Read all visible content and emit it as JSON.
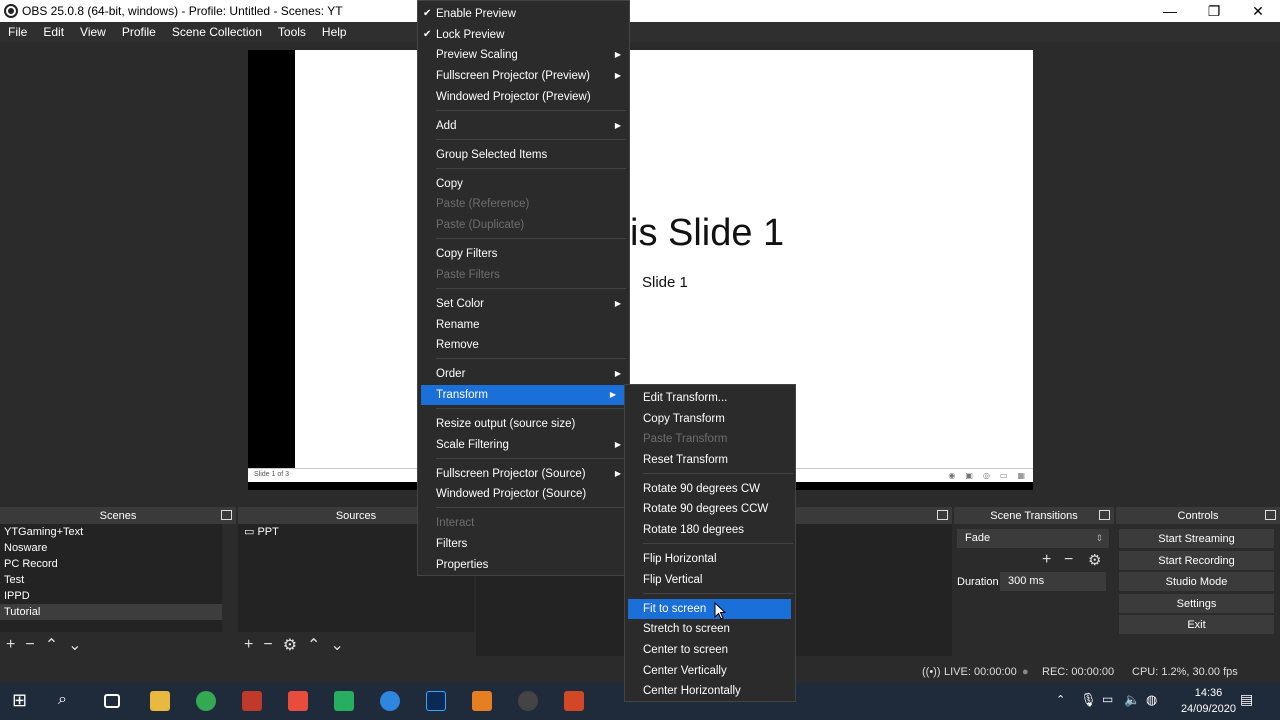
{
  "window": {
    "title": "OBS 25.0.8 (64-bit, windows) - Profile: Untitled - Scenes: YT",
    "minimize": "—",
    "maximize": "❐",
    "close": "✕"
  },
  "menubar": [
    "File",
    "Edit",
    "View",
    "Profile",
    "Scene Collection",
    "Tools",
    "Help"
  ],
  "preview": {
    "slide_title": "is Slide 1",
    "slide_subtitle": "Slide 1",
    "slide_counter": "Slide 1 of 3"
  },
  "docks": {
    "scenes": {
      "title": "Scenes",
      "items": [
        "YTGaming+Text",
        "Nosware",
        "PC Record",
        "Test",
        "IPPD",
        "Tutorial"
      ],
      "selected": "Tutorial"
    },
    "sources": {
      "title": "Sources",
      "items": [
        "PPT"
      ]
    },
    "transitions": {
      "title": "Scene Transitions",
      "selected": "Fade",
      "duration_label": "Duration",
      "duration_value": "300 ms"
    },
    "controls": {
      "title": "Controls",
      "buttons": [
        "Start Streaming",
        "Start Recording",
        "Studio Mode",
        "Settings",
        "Exit"
      ]
    }
  },
  "statusbar": {
    "live": "LIVE: 00:00:00",
    "rec": "REC: 00:00:00",
    "cpu": "CPU: 1.2%, 30.00 fps"
  },
  "context_menu": {
    "items": [
      "Enable Preview",
      "Lock Preview",
      "Preview Scaling",
      "Fullscreen Projector (Preview)",
      "Windowed Projector (Preview)",
      "Add",
      "Group Selected Items",
      "Copy",
      "Paste (Reference)",
      "Paste (Duplicate)",
      "Copy Filters",
      "Paste Filters",
      "Set Color",
      "Rename",
      "Remove",
      "Order",
      "Transform",
      "Resize output (source size)",
      "Scale Filtering",
      "Fullscreen Projector (Source)",
      "Windowed Projector (Source)",
      "Interact",
      "Filters",
      "Properties"
    ],
    "highlighted": "Transform"
  },
  "transform_menu": {
    "items": [
      "Edit Transform...",
      "Copy Transform",
      "Paste Transform",
      "Reset Transform",
      "Rotate 90 degrees CW",
      "Rotate 90 degrees CCW",
      "Rotate 180 degrees",
      "Flip Horizontal",
      "Flip Vertical",
      "Fit to screen",
      "Stretch to screen",
      "Center to screen",
      "Center Vertically",
      "Center Horizontally"
    ],
    "highlighted": "Fit to screen"
  },
  "taskbar": {
    "time": "14:36",
    "date": "24/09/2020"
  }
}
